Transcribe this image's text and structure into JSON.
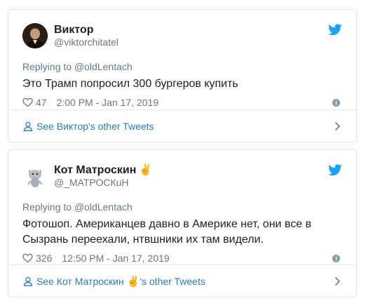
{
  "tweets": [
    {
      "display_name": "Виктор",
      "screen_name": "@viktorchitatel",
      "reply_prefix": "Replying to",
      "reply_to": "@oldLentach",
      "text": "Это Трамп попросил 300 бургеров купить",
      "likes": "47",
      "timestamp": "2:00 PM - Jan 17, 2019",
      "footer_link": "See Виктор's other Tweets",
      "avatar": "person-avatar"
    },
    {
      "display_name": "Кот Матроскин",
      "display_emoji": "✌",
      "screen_name": "@_МАТРОСКuН",
      "reply_prefix": "Replying to",
      "reply_to": "@oldLentach",
      "text": "Фотошоп. Американцев давно в Америке нет, они все в Сызрань переехали, нтвшники их там видели.",
      "likes": "326",
      "timestamp": "12:50 PM - Jan 17, 2019",
      "footer_prefix": "See Кот Матроскин",
      "footer_suffix": "'s other Tweets",
      "avatar": "cat-avatar"
    }
  ],
  "colors": {
    "twitter_blue": "#1da1f2",
    "link": "#2b7bb9",
    "muted": "#697882",
    "border": "#e1e8ed"
  }
}
